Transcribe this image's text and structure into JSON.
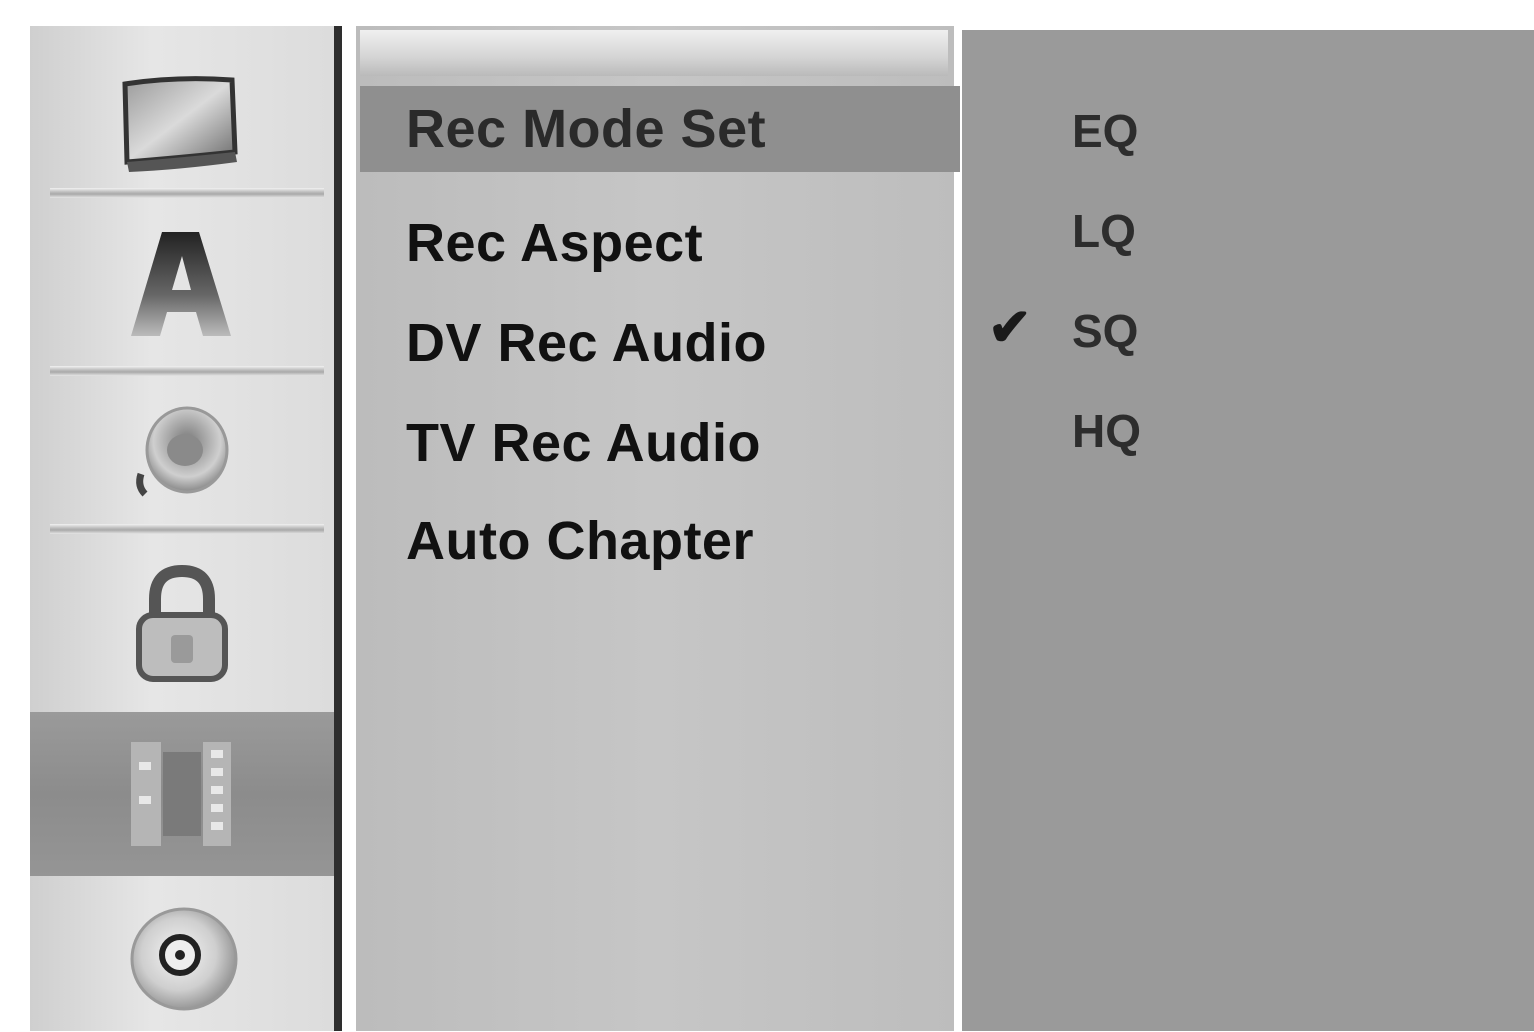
{
  "sidebar": {
    "icons": [
      "tv-screen-icon",
      "language-a-icon",
      "audio-speaker-icon",
      "lock-icon",
      "record-film-icon",
      "disc-icon"
    ],
    "active_index": 4
  },
  "menu": {
    "items": [
      "Rec Mode Set",
      "Rec Aspect",
      "DV Rec Audio",
      "TV Rec Audio",
      "Auto Chapter"
    ],
    "selected_index": 0
  },
  "options": {
    "items": [
      "EQ",
      "LQ",
      "SQ",
      "HQ"
    ],
    "checked_index": 2,
    "check_glyph": "✔"
  },
  "colors": {
    "highlight": "#8f8f8f",
    "options_bg": "#9a9a9a"
  }
}
